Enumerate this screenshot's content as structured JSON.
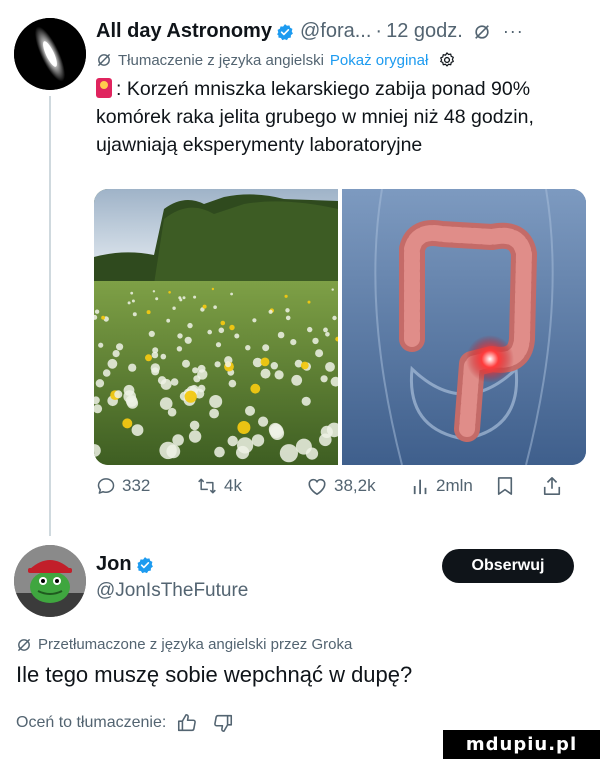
{
  "tweet": {
    "author_name": "All day Astronomy",
    "handle": "@fora...",
    "separator": "·",
    "time": "12 godz.",
    "translate_note": "Tłumaczenie z języka angielski",
    "show_original": "Pokaż oryginał",
    "text": "Korzeń mniszka lekarskiego zabija ponad 90% komórek raka jelita grubego w mniej niż 48 godzin, ujawniają eksperymenty laboratoryjne",
    "replies": "332",
    "reposts": "4k",
    "likes": "38,2k",
    "views": "2mln"
  },
  "reply": {
    "author_name": "Jon",
    "handle": "@JonIsTheFuture",
    "follow_label": "Obserwuj",
    "grok_note": "Przetłumaczone z języka angielski przez Groka",
    "text": "Ile tego muszę sobie wepchnąć w dupę?",
    "rate_label": "Oceń to tłumaczenie:"
  },
  "watermark": "mdupiu.pl",
  "colors": {
    "verified": "#1d9bf0",
    "link": "#1d9bf0",
    "secondary": "#536471",
    "button": "#0f1419"
  },
  "icons": [
    "verified-badge-icon",
    "grok-icon",
    "more-icon",
    "translate-settings-icon",
    "siren-emoji-icon",
    "reply-icon",
    "repost-icon",
    "like-icon",
    "views-icon",
    "bookmark-icon",
    "share-icon",
    "thumbs-up-icon",
    "thumbs-down-icon"
  ]
}
